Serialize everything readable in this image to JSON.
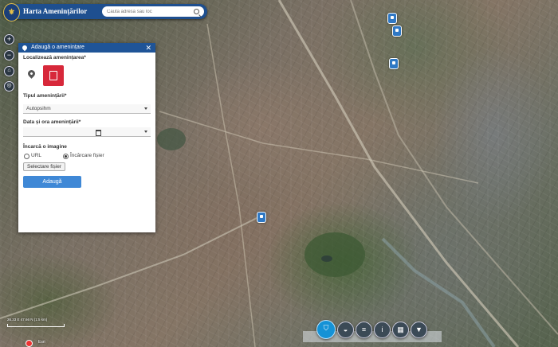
{
  "header": {
    "logo_icon": "coat-of-arms-icon",
    "title": "Harta Amenințărilor",
    "search_placeholder": "Caută adresă sau loc"
  },
  "map_controls": [
    "zoom-in-icon",
    "zoom-out-icon",
    "home-icon",
    "locate-icon"
  ],
  "dialog": {
    "title": "Adaugă o amenințare",
    "location_label": "Localizează amenințarea*",
    "type_label": "Tipul amenințării*",
    "type_value": "Autopsihm",
    "datetime_label": "Data și ora amenințării*",
    "datetime_value": "",
    "upload_label": "Încarcă o imagine",
    "radio_url": "URL",
    "radio_file": "Încărcare fișier",
    "selected_radio": "file",
    "file_button": "Selectare fișier",
    "submit": "Adaugă"
  },
  "map_overlay": {
    "coords": "26.33 E 47.66 N  (1:5 km)",
    "attribution": "Esri"
  },
  "toolbar": [
    "layers-icon",
    "basemap-icon",
    "list-icon",
    "info-icon",
    "grid-icon",
    "filter-icon"
  ],
  "colors": {
    "header": "#1e4f8f",
    "accent": "#3f88d6",
    "danger": "#d7283a",
    "marker": "#2f78c4"
  }
}
